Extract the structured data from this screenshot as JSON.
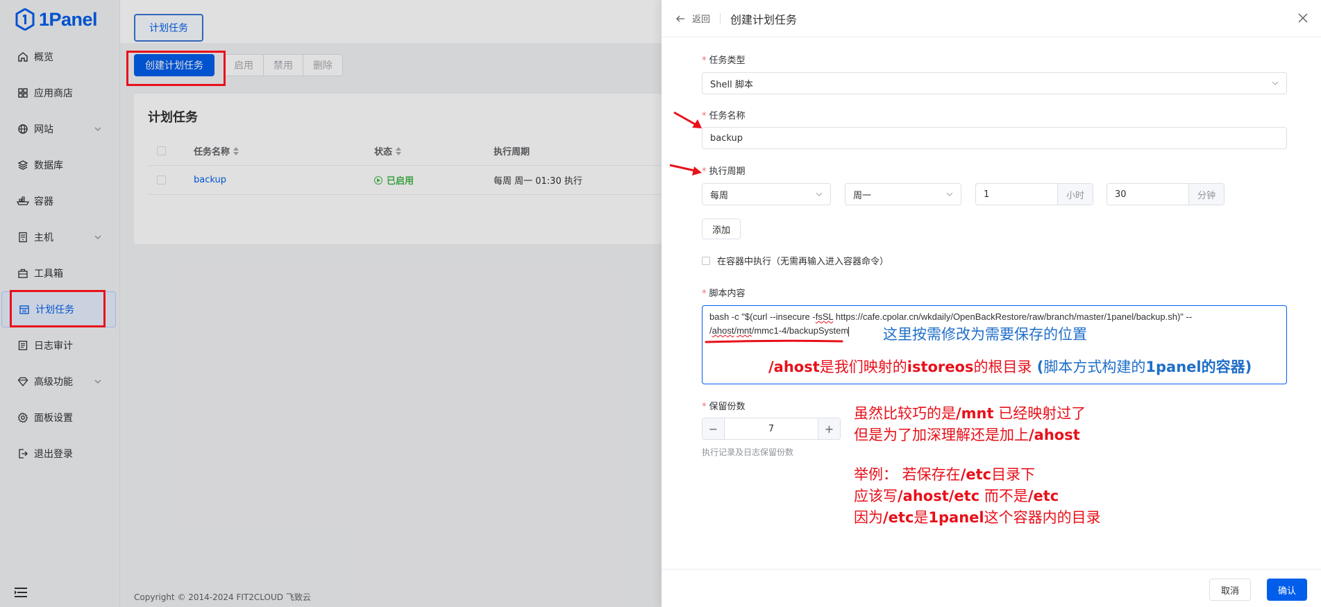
{
  "app": {
    "logo_text": "1Panel"
  },
  "sidebar": {
    "items": [
      {
        "label": "概览",
        "icon": "home-icon"
      },
      {
        "label": "应用商店",
        "icon": "grid-icon"
      },
      {
        "label": "网站",
        "icon": "globe-icon"
      },
      {
        "label": "数据库",
        "icon": "layers-icon"
      },
      {
        "label": "容器",
        "icon": "ship-icon"
      },
      {
        "label": "主机",
        "icon": "server-icon"
      },
      {
        "label": "工具箱",
        "icon": "toolbox-icon"
      },
      {
        "label": "计划任务",
        "icon": "calendar-icon"
      },
      {
        "label": "日志审计",
        "icon": "log-icon"
      },
      {
        "label": "高级功能",
        "icon": "diamond-icon"
      },
      {
        "label": "面板设置",
        "icon": "gear-icon"
      },
      {
        "label": "退出登录",
        "icon": "logout-icon"
      }
    ],
    "active": "计划任务"
  },
  "main": {
    "tab_label": "计划任务",
    "toolbar": {
      "create": "创建计划任务",
      "enable": "启用",
      "disable": "禁用",
      "delete": "删除"
    },
    "card_title": "计划任务",
    "table": {
      "headers": {
        "name": "任务名称",
        "status": "状态",
        "cycle": "执行周期"
      },
      "rows": [
        {
          "name": "backup",
          "status": "已启用",
          "cycle": "每周 周一 01:30 执行"
        }
      ]
    },
    "footer": "Copyright © 2014-2024 FIT2CLOUD 飞致云"
  },
  "drawer": {
    "back": "返回",
    "title": "创建计划任务",
    "task_type": {
      "label": "任务类型",
      "value": "Shell 脚本"
    },
    "task_name": {
      "label": "任务名称",
      "value": "backup"
    },
    "cycle": {
      "label": "执行周期",
      "frequency": "每周",
      "weekday": "周一",
      "hour": "1",
      "hour_unit": "小时",
      "minute": "30",
      "minute_unit": "分钟",
      "add_button": "添加"
    },
    "in_container": "在容器中执行（无需再输入进入容器命令）",
    "script": {
      "label": "脚本内容",
      "line1_pre": "bash -c \"$(curl --insecure -",
      "line1_sq": "fsSL",
      "line1_post": " https://cafe.cpolar.cn/wkdaily/OpenBackRestore/raw/branch/master/1panel/backup.sh)\" --",
      "line2_pre": "/",
      "line2_sq1": "ahost",
      "line2_mid": "/",
      "line2_sq2": "mnt",
      "line2_post": "/mmc1-4/backupSystem"
    },
    "retain": {
      "label": "保留份数",
      "value": "7",
      "hint": "执行记录及日志保留份数"
    },
    "footer": {
      "cancel": "取消",
      "confirm": "确认"
    }
  },
  "annotations": {
    "a1": "这里按需修改为需要保存的位置",
    "a2_p1": "/ahost",
    "a2_p2": "是我们映射的",
    "a2_p3": "istoreos",
    "a2_p4": "的根目录",
    "a2_p5": " (",
    "a2_p6": "脚本方式构建的",
    "a2_p7": "1panel",
    "a2_p8": "的容器)",
    "a3_l1_p1": "虽然比较巧的是",
    "a3_l1_p2": "/mnt",
    "a3_l1_p3": " 已经映射过了",
    "a3_l2_p1": "但是为了加深理解还是加上",
    "a3_l2_p2": "/ahost",
    "a4_l1_p1": "举例： 若保存在",
    "a4_l1_p2": "/etc",
    "a4_l1_p3": "目录下",
    "a4_l2_p1": "应该写",
    "a4_l2_p2": "/ahost/etc",
    "a4_l2_p3": " 而不是",
    "a4_l2_p4": "/etc",
    "a4_l3_p1": "因为",
    "a4_l3_p2": "/etc",
    "a4_l3_p3": "是",
    "a4_l3_p4": "1panel",
    "a4_l3_p5": "这个容器内的目录"
  },
  "colors": {
    "primary": "#005eeb",
    "annotation_red": "#e8101a",
    "annotation_blue": "#1f6ec8",
    "success": "#42b648"
  }
}
